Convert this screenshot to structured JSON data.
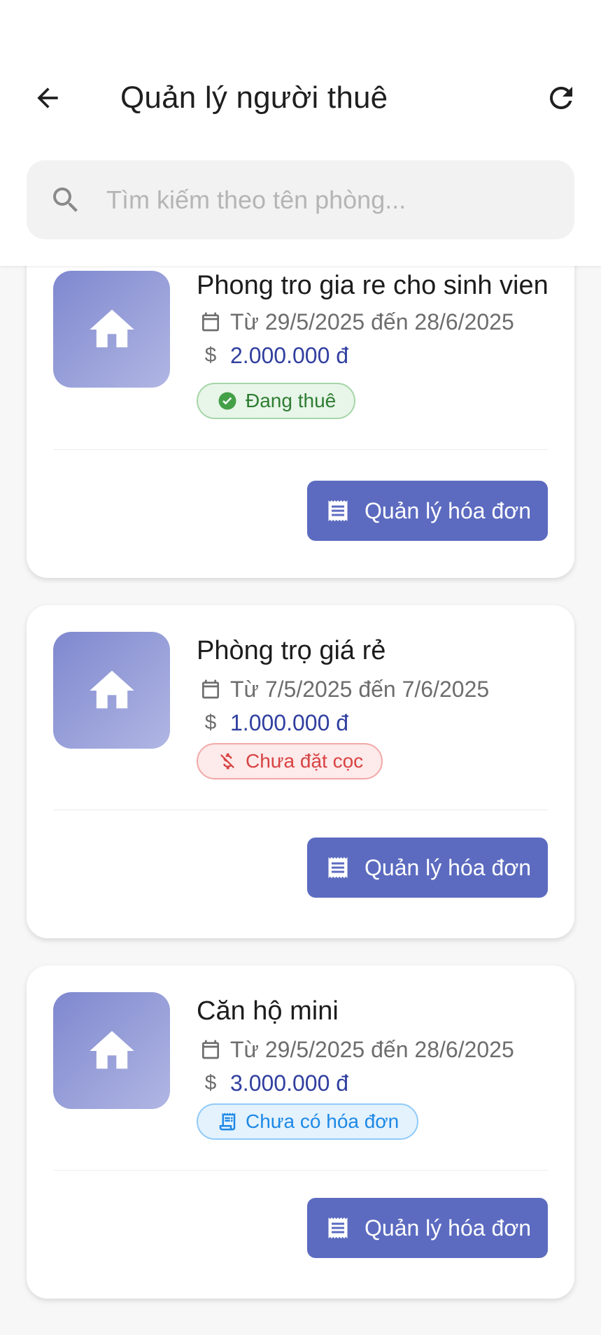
{
  "header": {
    "title": "Quản lý người thuê",
    "back_icon": "arrow-left-icon",
    "refresh_icon": "refresh-icon"
  },
  "search": {
    "placeholder": "Tìm kiếm theo tên phòng...",
    "value": ""
  },
  "colors": {
    "primary": "#5c6bc0",
    "price": "#303f9f",
    "status_rented": "#2e7d32",
    "status_no_deposit": "#d84343",
    "status_no_invoice": "#1e88e5"
  },
  "rooms": [
    {
      "name": "Phong tro gia re cho sinh vien",
      "date_range": "Từ 29/5/2025 đến 28/6/2025",
      "price": "2.000.000 đ",
      "status": "Đang thuê",
      "status_icon": "check-circle-icon",
      "button_label": "Quản lý hóa đơn"
    },
    {
      "name": "Phòng trọ giá rẻ",
      "date_range": "Từ 7/5/2025 đến 7/6/2025",
      "price": "1.000.000 đ",
      "status": "Chưa đặt cọc",
      "status_icon": "money-off-icon",
      "button_label": "Quản lý hóa đơn"
    },
    {
      "name": "Căn hộ mini",
      "date_range": "Từ 29/5/2025 đến 28/6/2025",
      "price": "3.000.000 đ",
      "status": "Chưa có hóa đơn",
      "status_icon": "receipt-icon",
      "button_label": "Quản lý hóa đơn"
    }
  ],
  "price_symbol": "$"
}
